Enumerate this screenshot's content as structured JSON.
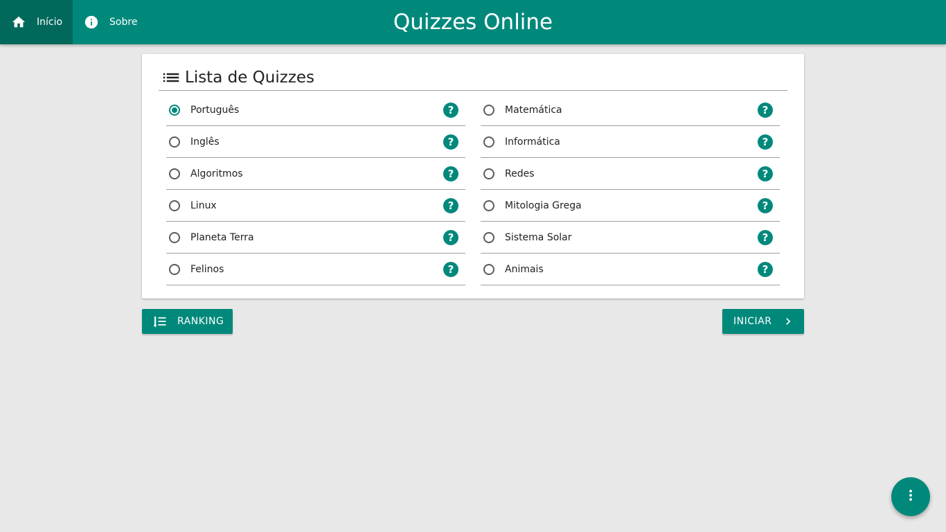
{
  "nav": {
    "home_label": "Início",
    "home_icon": "home-icon",
    "about_label": "Sobre",
    "about_icon": "info-icon"
  },
  "app_title": "Quizzes Online",
  "card": {
    "title": "Lista de Quizzes",
    "icon": "list-icon"
  },
  "quizzes_left": [
    {
      "label": "Português",
      "checked": true
    },
    {
      "label": "Inglês",
      "checked": false
    },
    {
      "label": "Algoritmos",
      "checked": false
    },
    {
      "label": "Linux",
      "checked": false
    },
    {
      "label": "Planeta Terra",
      "checked": false
    },
    {
      "label": "Felinos",
      "checked": false
    }
  ],
  "quizzes_right": [
    {
      "label": "Matemática",
      "checked": false
    },
    {
      "label": "Informática",
      "checked": false
    },
    {
      "label": "Redes",
      "checked": false
    },
    {
      "label": "Mitologia Grega",
      "checked": false
    },
    {
      "label": "Sistema Solar",
      "checked": false
    },
    {
      "label": "Animais",
      "checked": false
    }
  ],
  "help_glyph": "?",
  "buttons": {
    "ranking_label": "RANKING",
    "ranking_icon": "sort-numeric-icon",
    "start_label": "INICIAR",
    "start_icon": "chevron-right-icon"
  },
  "fab_icon": "more-vert-icon",
  "colors": {
    "primary": "#00897b",
    "primary_dark": "#00695c",
    "background": "#e8e8e8"
  }
}
